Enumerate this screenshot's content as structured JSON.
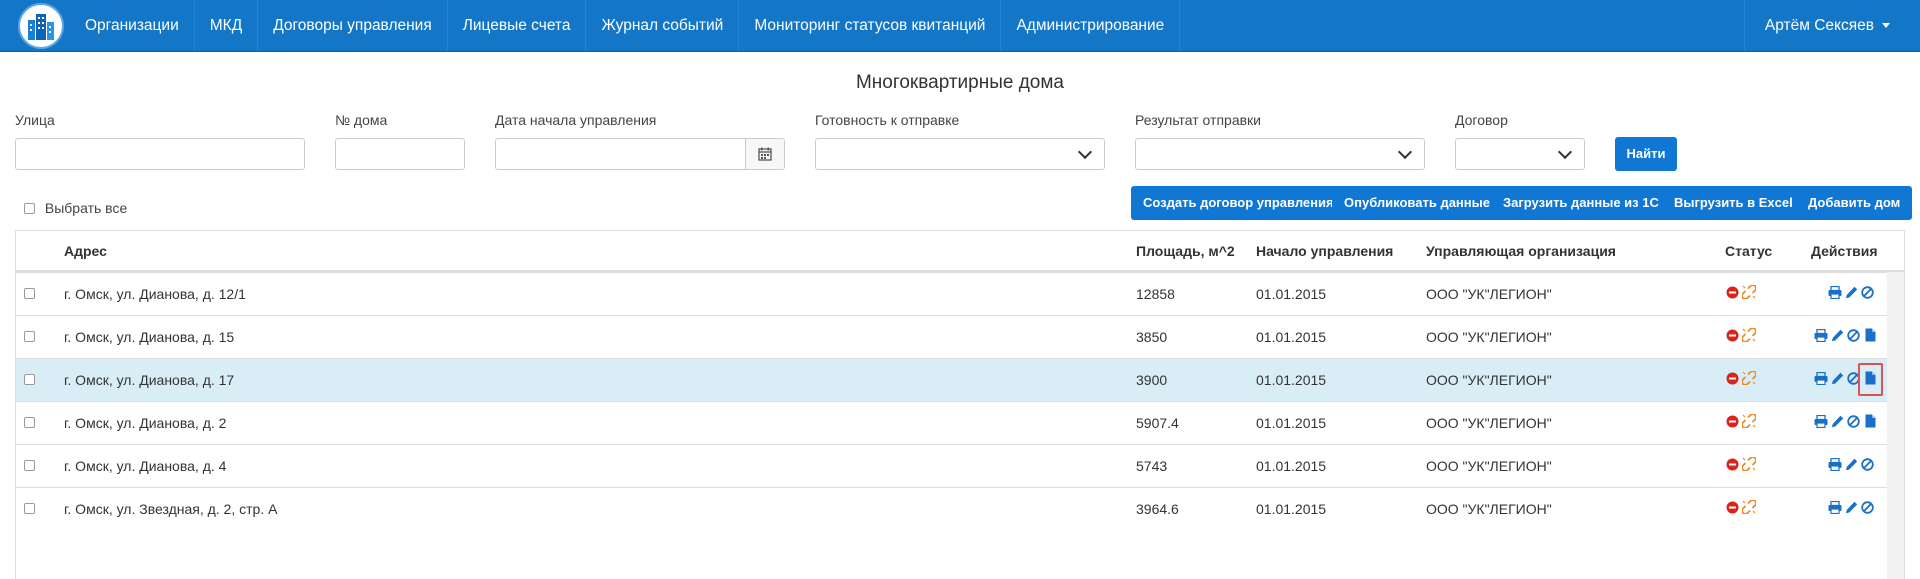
{
  "navbar": {
    "logo": "building-logo",
    "items": [
      {
        "label": "Организации"
      },
      {
        "label": "МКД"
      },
      {
        "label": "Договоры управления"
      },
      {
        "label": "Лицевые счета"
      },
      {
        "label": "Журнал событий"
      },
      {
        "label": "Мониторинг статусов квитанций"
      },
      {
        "label": "Администрирование"
      }
    ],
    "user": "Артём Сексяев"
  },
  "page": {
    "title": "Многоквартирные дома"
  },
  "filters": {
    "street": {
      "label": "Улица",
      "value": ""
    },
    "house_no": {
      "label": "№ дома",
      "value": ""
    },
    "start_date": {
      "label": "Дата начала управления",
      "value": ""
    },
    "readiness": {
      "label": "Готовность к отправке",
      "value": ""
    },
    "send_result": {
      "label": "Результат отправки",
      "value": ""
    },
    "contract": {
      "label": "Договор",
      "value": ""
    },
    "find_button": "Найти"
  },
  "toolbar": {
    "select_all": "Выбрать все",
    "create_contract": "Создать договор управления",
    "publish": "Опубликовать данные",
    "load_1c": "Загрузить данные из 1С",
    "export_excel": "Выгрузить в Excel",
    "add_house": "Добавить дом"
  },
  "table": {
    "columns": {
      "address": "Адрес",
      "area": "Площадь, м^2",
      "start": "Начало управления",
      "org": "Управляющая организация",
      "status": "Статус",
      "actions": "Действия"
    },
    "rows": [
      {
        "address": "г. Омск, ул. Дианова, д. 12/1",
        "area": "12858",
        "start": "01.01.2015",
        "org": "ООО \"УК\"ЛЕГИОН\"",
        "has_doc": false,
        "selected": false
      },
      {
        "address": "г. Омск, ул. Дианова, д. 15",
        "area": "3850",
        "start": "01.01.2015",
        "org": "ООО \"УК\"ЛЕГИОН\"",
        "has_doc": true,
        "selected": false
      },
      {
        "address": "г. Омск, ул. Дианова, д. 17",
        "area": "3900",
        "start": "01.01.2015",
        "org": "ООО \"УК\"ЛЕГИОН\"",
        "has_doc": true,
        "selected": true
      },
      {
        "address": "г. Омск, ул. Дианова, д. 2",
        "area": "5907.4",
        "start": "01.01.2015",
        "org": "ООО \"УК\"ЛЕГИОН\"",
        "has_doc": true,
        "selected": false
      },
      {
        "address": "г. Омск, ул. Дианова, д. 4",
        "area": "5743",
        "start": "01.01.2015",
        "org": "ООО \"УК\"ЛЕГИОН\"",
        "has_doc": false,
        "selected": false
      },
      {
        "address": "г. Омск, ул. Звездная, д. 2, стр. А",
        "area": "3964.6",
        "start": "01.01.2015",
        "org": "ООО \"УК\"ЛЕГИОН\"",
        "has_doc": false,
        "selected": false
      }
    ]
  },
  "colors": {
    "navbar": "#1476c7",
    "button": "#1077d4",
    "selected_row": "#d9edf7",
    "status_red": "#d9231d",
    "status_orange": "#f08a24",
    "action_blue": "#1a6fc9",
    "highlight": "#d9534f"
  }
}
